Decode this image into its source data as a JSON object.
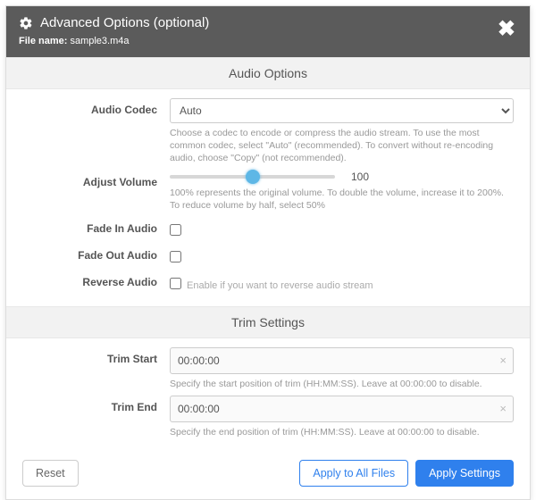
{
  "header": {
    "title": "Advanced Options (optional)",
    "filename_label": "File name:",
    "filename_value": "sample3.m4a"
  },
  "sections": {
    "audio_title": "Audio Options",
    "trim_title": "Trim Settings"
  },
  "audio": {
    "codec_label": "Audio Codec",
    "codec_value": "Auto",
    "codec_help": "Choose a codec to encode or compress the audio stream. To use the most common codec, select \"Auto\" (recommended). To convert without re-encoding audio, choose \"Copy\" (not recommended).",
    "volume_label": "Adjust Volume",
    "volume_value": "100",
    "volume_help": "100% represents the original volume. To double the volume, increase it to 200%. To reduce volume by half, select 50%",
    "fadein_label": "Fade In Audio",
    "fadeout_label": "Fade Out Audio",
    "reverse_label": "Reverse Audio",
    "reverse_help": "Enable if you want to reverse audio stream"
  },
  "trim": {
    "start_label": "Trim Start",
    "start_value": "00:00:00",
    "start_help": "Specify the start position of trim (HH:MM:SS). Leave at 00:00:00 to disable.",
    "end_label": "Trim End",
    "end_value": "00:00:00",
    "end_help": "Specify the end position of trim (HH:MM:SS). Leave at 00:00:00 to disable."
  },
  "footer": {
    "reset": "Reset",
    "apply_all": "Apply to All Files",
    "apply": "Apply Settings"
  }
}
